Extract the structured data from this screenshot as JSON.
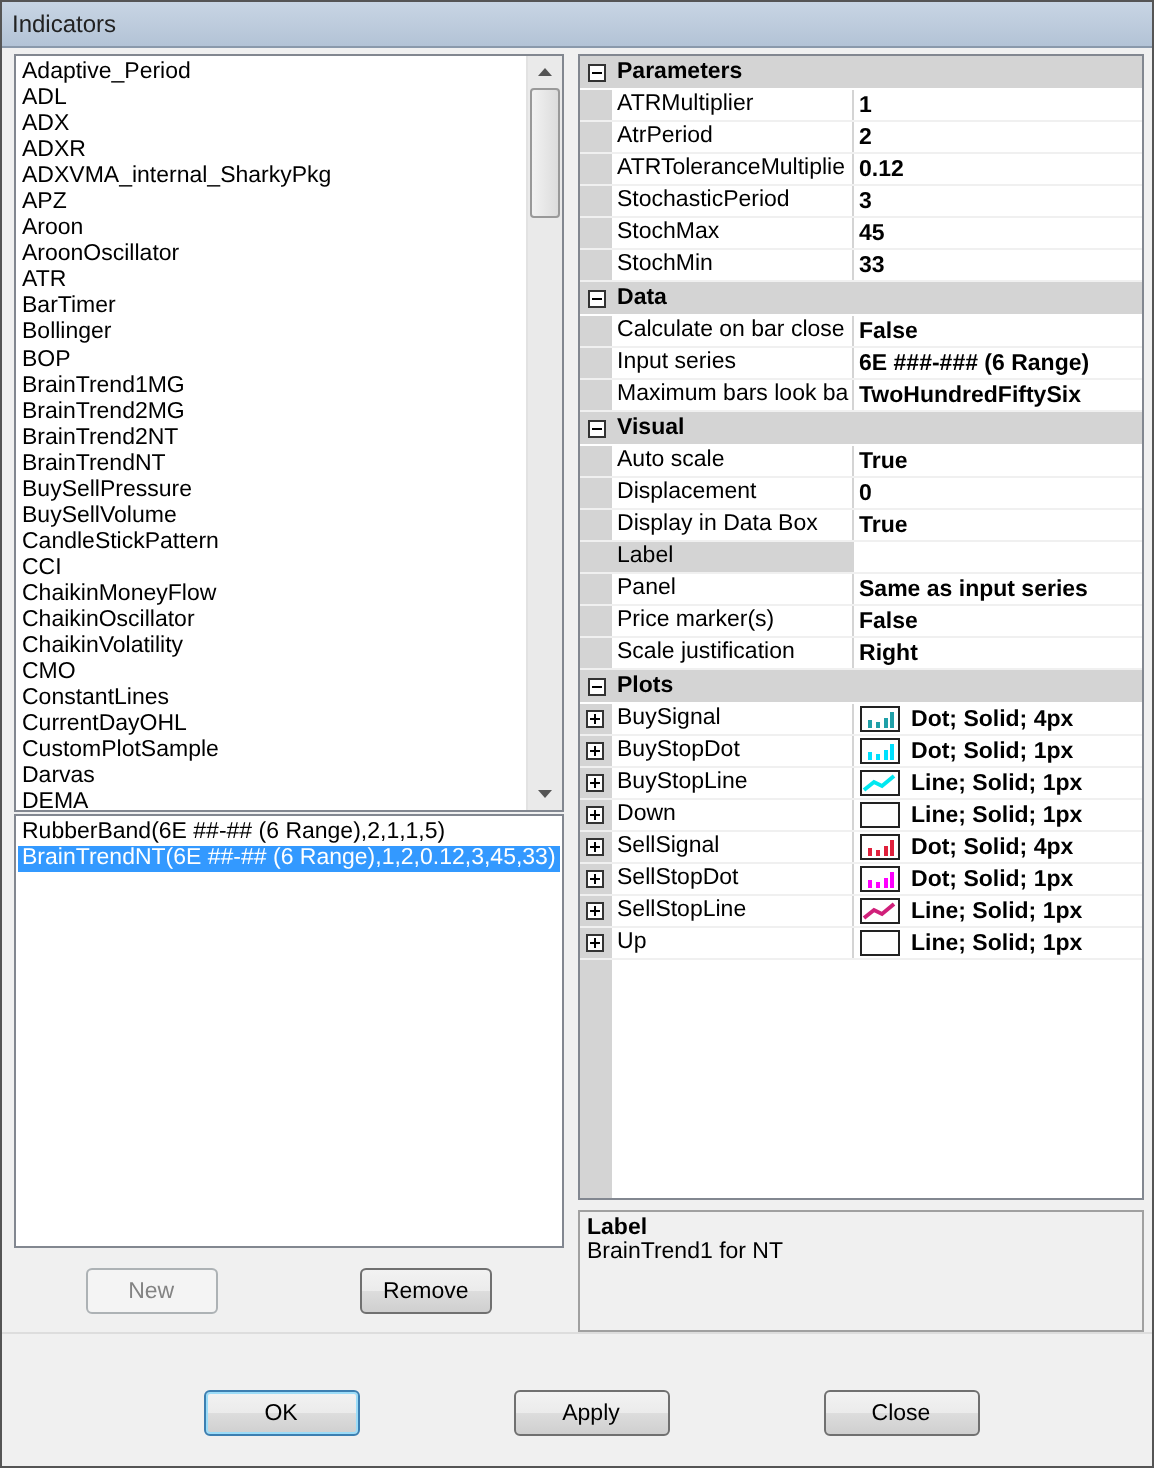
{
  "window": {
    "title": "Indicators"
  },
  "indicators": [
    "Adaptive_Period",
    "ADL",
    "ADX",
    "ADXR",
    "ADXVMA_internal_SharkyPkg",
    "APZ",
    "Aroon",
    "AroonOscillator",
    "ATR",
    "BarTimer",
    "Bollinger",
    "BOP",
    "BrainTrend1MG",
    "BrainTrend2MG",
    "BrainTrend2NT",
    "BrainTrendNT",
    "BuySellPressure",
    "BuySellVolume",
    "CandleStickPattern",
    "CCI",
    "ChaikinMoneyFlow",
    "ChaikinOscillator",
    "ChaikinVolatility",
    "CMO",
    "ConstantLines",
    "CurrentDayOHL",
    "CustomPlotSample",
    "Darvas",
    "DEMA"
  ],
  "applied": [
    {
      "label": "RubberBand(6E ##-## (6 Range),2,1,1,5)",
      "selected": false
    },
    {
      "label": "BrainTrendNT(6E ##-## (6 Range),1,2,0.12,3,45,33)",
      "selected": true
    }
  ],
  "list_buttons": [
    {
      "label": "New",
      "disabled": true
    },
    {
      "label": "Remove",
      "disabled": false
    }
  ],
  "categories": [
    {
      "name": "Parameters",
      "expanded": true,
      "rows": [
        {
          "name": "ATRMultiplier",
          "value": "1",
          "selected": false
        },
        {
          "name": "AtrPeriod",
          "value": "2",
          "selected": false
        },
        {
          "name": "ATRToleranceMultiplie",
          "value": "0.12",
          "selected": false
        },
        {
          "name": "StochasticPeriod",
          "value": "3",
          "selected": false
        },
        {
          "name": "StochMax",
          "value": "45",
          "selected": false
        },
        {
          "name": "StochMin",
          "value": "33",
          "selected": false
        }
      ]
    },
    {
      "name": "Data",
      "expanded": true,
      "rows": [
        {
          "name": "Calculate on bar close",
          "value": "False",
          "selected": false
        },
        {
          "name": "Input series",
          "value": "6E ###-### (6 Range)",
          "selected": false
        },
        {
          "name": "Maximum bars look ba",
          "value": "TwoHundredFiftySix",
          "selected": false
        }
      ]
    },
    {
      "name": "Visual",
      "expanded": true,
      "rows": [
        {
          "name": "Auto scale",
          "value": "True",
          "selected": false
        },
        {
          "name": "Displacement",
          "value": "0",
          "selected": false
        },
        {
          "name": "Display in Data Box",
          "value": "True",
          "selected": false
        },
        {
          "name": "Label",
          "selected": true
        },
        {
          "name": "Panel",
          "value": "Same as input series",
          "selected": false
        },
        {
          "name": "Price marker(s)",
          "value": "False",
          "selected": false
        },
        {
          "name": "Scale justification",
          "value": "Right",
          "selected": false
        }
      ]
    },
    {
      "name": "Plots",
      "expanded": true,
      "plots": [
        {
          "name": "BuySignal",
          "kind": "bars",
          "color": "#20a0a8",
          "value": "Dot; Solid; 4px",
          "expanded": false
        },
        {
          "name": "BuyStopDot",
          "kind": "bars",
          "color": "#00e0ff",
          "value": "Dot; Solid; 1px",
          "expanded": false
        },
        {
          "name": "BuyStopLine",
          "kind": "line",
          "color": "#00e8f0",
          "value": "Line; Solid; 1px",
          "expanded": false
        },
        {
          "name": "Down",
          "kind": "empty",
          "value": "Line; Solid; 1px",
          "expanded": false
        },
        {
          "name": "SellSignal",
          "kind": "bars",
          "color": "#e0203c",
          "value": "Dot; Solid; 4px",
          "expanded": false
        },
        {
          "name": "SellStopDot",
          "kind": "bars",
          "color": "#ff00ff",
          "value": "Dot; Solid; 1px",
          "expanded": false
        },
        {
          "name": "SellStopLine",
          "kind": "line",
          "color": "#d0207a",
          "value": "Line; Solid; 1px",
          "expanded": false
        },
        {
          "name": "Up",
          "kind": "empty",
          "value": "Line; Solid; 1px",
          "expanded": false
        }
      ]
    }
  ],
  "description": {
    "title": "Label",
    "text": "BrainTrend1 for NT"
  },
  "dialog_buttons": [
    {
      "label": "OK",
      "default": true
    },
    {
      "label": "Apply",
      "default": false
    },
    {
      "label": "Close",
      "default": false
    }
  ]
}
